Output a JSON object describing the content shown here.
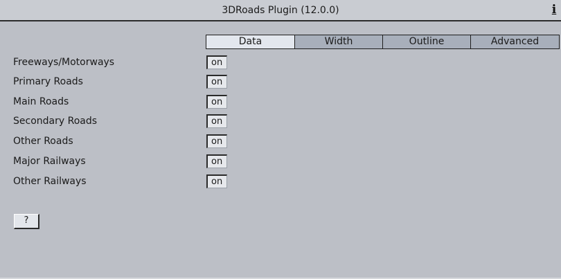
{
  "window": {
    "title": "3DRoads Plugin (12.0.0)",
    "info_label": "i"
  },
  "tabs": [
    {
      "label": "Data",
      "active": true
    },
    {
      "label": "Width",
      "active": false
    },
    {
      "label": "Outline",
      "active": false
    },
    {
      "label": "Advanced",
      "active": false
    }
  ],
  "rows": [
    {
      "label": "Freeways/Motorways",
      "value": "on"
    },
    {
      "label": "Primary Roads",
      "value": "on"
    },
    {
      "label": "Main Roads",
      "value": "on"
    },
    {
      "label": "Secondary Roads",
      "value": "on"
    },
    {
      "label": "Other Roads",
      "value": "on"
    },
    {
      "label": "Major Railways",
      "value": "on"
    },
    {
      "label": "Other Railways",
      "value": "on"
    }
  ],
  "help_button": {
    "label": "?"
  }
}
